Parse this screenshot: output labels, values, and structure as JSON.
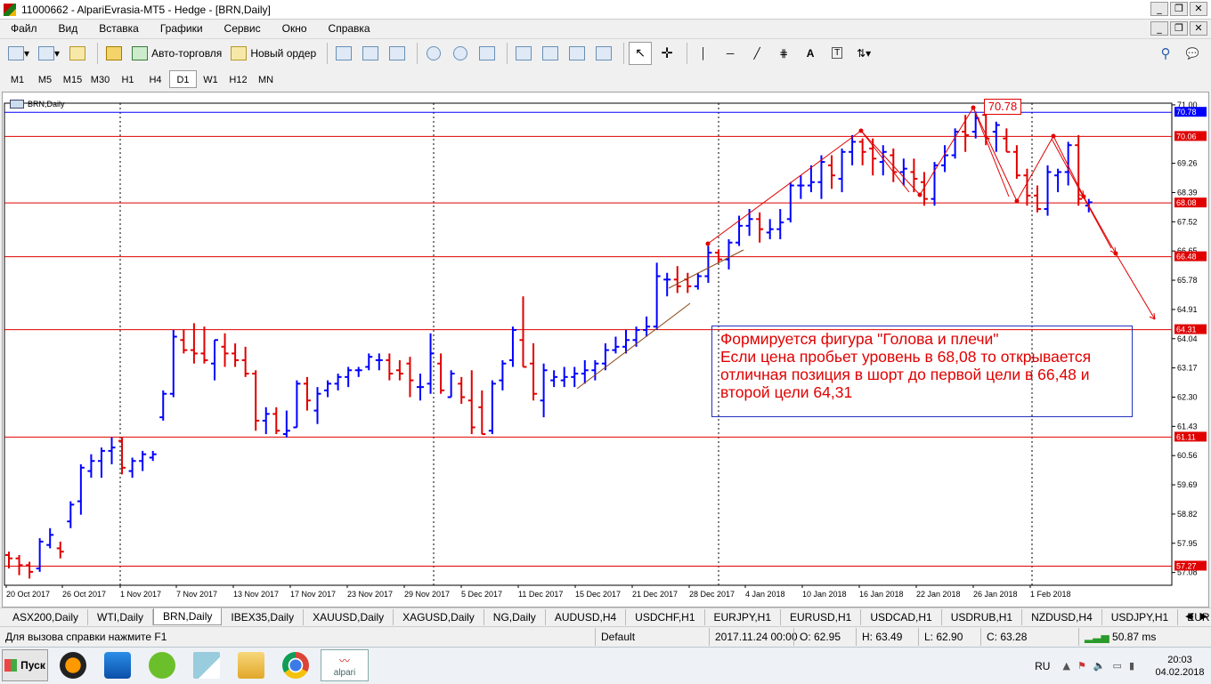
{
  "window": {
    "title": "11000662 - AlpariEvrasia-MT5 - Hedge - [BRN,Daily]"
  },
  "menu": [
    "Файл",
    "Вид",
    "Вставка",
    "Графики",
    "Сервис",
    "Окно",
    "Справка"
  ],
  "toolbar": {
    "autotrade": "Авто-торговля",
    "new_order": "Новый ордер"
  },
  "timeframes": [
    "M1",
    "M5",
    "M15",
    "M30",
    "H1",
    "H4",
    "D1",
    "W1",
    "H12",
    "MN"
  ],
  "active_timeframe": "D1",
  "chart": {
    "symbol_label": "BRN,Daily",
    "highlight_price": "70.78",
    "annotation": [
      "Формируется фигура \"Голова и плечи\"",
      "Если цена пробьет уровень в 68,08 то открывается",
      "отличная позиция в шорт до первой цели в 66,48 и",
      "второй цели 64,31"
    ]
  },
  "chart_data": {
    "type": "bar",
    "symbol": "BRN",
    "timeframe": "Daily",
    "ylim": [
      56.7,
      71.05
    ],
    "y_ticks": [
      71.0,
      70.78,
      70.06,
      69.26,
      68.39,
      68.08,
      67.52,
      66.65,
      66.48,
      65.78,
      64.91,
      64.31,
      64.04,
      63.17,
      62.3,
      61.43,
      61.11,
      60.56,
      59.69,
      58.82,
      57.95,
      57.27,
      57.08
    ],
    "date_labels": [
      "20 Oct 2017",
      "26 Oct 2017",
      "1 Nov 2017",
      "7 Nov 2017",
      "13 Nov 2017",
      "17 Nov 2017",
      "23 Nov 2017",
      "29 Nov 2017",
      "5 Dec 2017",
      "11 Dec 2017",
      "15 Dec 2017",
      "21 Dec 2017",
      "28 Dec 2017",
      "4 Jan 2018",
      "10 Jan 2018",
      "16 Jan 2018",
      "22 Jan 2018",
      "26 Jan 2018",
      "1 Feb 2018"
    ],
    "hlines": [
      {
        "price": 70.78,
        "color": "#0000ff",
        "label": "70.78"
      },
      {
        "price": 70.06,
        "color": "#e00000",
        "label": "70.06"
      },
      {
        "price": 68.08,
        "color": "#e00000",
        "label": "68.08"
      },
      {
        "price": 66.48,
        "color": "#e00000",
        "label": "66.48"
      },
      {
        "price": 64.31,
        "color": "#e00000",
        "label": "64.31"
      },
      {
        "price": 61.11,
        "color": "#e00000",
        "label": "61.11"
      },
      {
        "price": 57.27,
        "color": "#e00000",
        "label": "57.27"
      }
    ],
    "up_color": "#0000ff",
    "down_color": "#e00000",
    "ohlc": [
      [
        57.6,
        57.7,
        57.2,
        57.5
      ],
      [
        57.5,
        57.6,
        57.0,
        57.3
      ],
      [
        57.3,
        57.4,
        56.9,
        57.1
      ],
      [
        57.2,
        58.1,
        57.1,
        58.0
      ],
      [
        57.9,
        58.4,
        57.8,
        58.2
      ],
      [
        57.8,
        58.0,
        57.5,
        57.7
      ],
      [
        58.6,
        59.2,
        58.4,
        59.1
      ],
      [
        59.2,
        60.3,
        58.8,
        60.2
      ],
      [
        60.1,
        60.6,
        59.9,
        60.4
      ],
      [
        60.4,
        60.8,
        59.9,
        60.7
      ],
      [
        60.7,
        61.1,
        60.3,
        60.8
      ],
      [
        61.0,
        61.1,
        60.0,
        60.2
      ],
      [
        60.1,
        60.5,
        59.9,
        60.4
      ],
      [
        60.4,
        60.7,
        60.1,
        60.6
      ],
      [
        60.5,
        60.7,
        60.4,
        60.6
      ],
      [
        61.7,
        62.5,
        61.6,
        62.4
      ],
      [
        62.4,
        64.3,
        62.3,
        64.1
      ],
      [
        64.0,
        64.3,
        63.6,
        63.7
      ],
      [
        63.7,
        64.5,
        63.3,
        63.6
      ],
      [
        63.6,
        64.4,
        63.3,
        63.4
      ],
      [
        63.3,
        64.0,
        62.8,
        64.0
      ],
      [
        63.8,
        64.2,
        63.2,
        63.6
      ],
      [
        63.6,
        63.9,
        63.2,
        63.4
      ],
      [
        63.4,
        63.8,
        62.9,
        63.0
      ],
      [
        63.0,
        63.1,
        61.3,
        61.6
      ],
      [
        61.6,
        62.0,
        61.2,
        61.8
      ],
      [
        61.8,
        62.0,
        61.2,
        61.3
      ],
      [
        61.2,
        61.9,
        61.1,
        61.3
      ],
      [
        61.4,
        62.8,
        61.4,
        62.7
      ],
      [
        62.7,
        62.9,
        61.9,
        62.2
      ],
      [
        61.9,
        62.6,
        61.5,
        62.4
      ],
      [
        62.5,
        62.8,
        62.3,
        62.7
      ],
      [
        62.7,
        63.0,
        62.5,
        62.9
      ],
      [
        62.9,
        63.2,
        62.6,
        63.1
      ],
      [
        63.1,
        63.2,
        62.9,
        63.1
      ],
      [
        63.2,
        63.6,
        63.1,
        63.5
      ],
      [
        63.4,
        63.6,
        63.1,
        63.4
      ],
      [
        63.4,
        63.6,
        62.8,
        63.0
      ],
      [
        63.1,
        63.4,
        62.8,
        63.0
      ],
      [
        63.3,
        63.5,
        62.3,
        62.8
      ],
      [
        62.6,
        63.0,
        62.2,
        62.6
      ],
      [
        62.7,
        64.2,
        62.4,
        63.6
      ],
      [
        63.3,
        63.6,
        62.4,
        62.5
      ],
      [
        62.3,
        63.1,
        62.3,
        63.0
      ],
      [
        62.7,
        62.9,
        62.1,
        62.3
      ],
      [
        62.2,
        63.1,
        61.2,
        61.4
      ],
      [
        62.0,
        62.5,
        61.2,
        61.2
      ],
      [
        61.3,
        62.8,
        61.2,
        62.7
      ],
      [
        62.8,
        63.4,
        62.5,
        63.3
      ],
      [
        63.4,
        64.4,
        63.2,
        64.3
      ],
      [
        64.0,
        65.3,
        63.2,
        63.2
      ],
      [
        63.3,
        63.9,
        62.2,
        62.4
      ],
      [
        62.2,
        63.3,
        61.7,
        63.1
      ],
      [
        62.8,
        63.1,
        62.6,
        62.9
      ],
      [
        62.8,
        63.2,
        62.6,
        62.9
      ],
      [
        62.9,
        63.2,
        62.6,
        63.0
      ],
      [
        63.0,
        63.4,
        62.7,
        63.1
      ],
      [
        63.1,
        63.4,
        62.8,
        63.3
      ],
      [
        63.3,
        63.9,
        63.1,
        63.7
      ],
      [
        63.7,
        64.1,
        63.6,
        63.8
      ],
      [
        63.8,
        64.3,
        63.6,
        64.0
      ],
      [
        64.0,
        64.4,
        63.8,
        64.3
      ],
      [
        64.3,
        64.7,
        64.1,
        64.4
      ],
      [
        64.4,
        66.3,
        64.3,
        65.9
      ],
      [
        65.8,
        66.0,
        65.3,
        65.8
      ],
      [
        65.8,
        66.2,
        65.4,
        65.6
      ],
      [
        65.8,
        66.0,
        65.4,
        65.6
      ],
      [
        65.6,
        66.0,
        65.5,
        65.9
      ],
      [
        65.9,
        66.8,
        65.7,
        66.6
      ],
      [
        66.6,
        66.7,
        66.3,
        66.4
      ],
      [
        66.4,
        67.0,
        66.1,
        66.9
      ],
      [
        66.9,
        67.7,
        66.8,
        67.4
      ],
      [
        67.4,
        67.9,
        67.1,
        67.6
      ],
      [
        67.6,
        67.8,
        66.9,
        67.3
      ],
      [
        67.2,
        67.6,
        67.0,
        67.3
      ],
      [
        67.3,
        67.9,
        67.0,
        67.5
      ],
      [
        67.6,
        68.7,
        67.5,
        68.6
      ],
      [
        68.6,
        68.9,
        68.2,
        68.6
      ],
      [
        68.6,
        69.2,
        68.4,
        68.7
      ],
      [
        68.7,
        69.5,
        68.2,
        69.3
      ],
      [
        69.2,
        69.5,
        68.5,
        68.9
      ],
      [
        68.8,
        69.7,
        68.4,
        69.6
      ],
      [
        69.6,
        70.1,
        69.2,
        69.9
      ],
      [
        69.9,
        70.0,
        69.2,
        69.6
      ],
      [
        69.7,
        70.0,
        68.9,
        69.4
      ],
      [
        69.3,
        69.8,
        68.9,
        69.6
      ],
      [
        69.5,
        69.7,
        68.7,
        69.0
      ],
      [
        69.0,
        69.4,
        68.6,
        69.1
      ],
      [
        69.0,
        69.4,
        68.4,
        68.8
      ],
      [
        68.7,
        69.0,
        68.0,
        68.2
      ],
      [
        68.2,
        69.3,
        68.0,
        69.2
      ],
      [
        69.2,
        69.8,
        69.0,
        69.5
      ],
      [
        69.5,
        70.3,
        69.4,
        70.2
      ],
      [
        70.2,
        70.7,
        69.6,
        70.1
      ],
      [
        70.2,
        70.8,
        70.0,
        70.6
      ],
      [
        70.7,
        70.8,
        69.8,
        70.0
      ],
      [
        70.2,
        70.5,
        69.6,
        70.4
      ],
      [
        70.0,
        70.3,
        69.6,
        69.6
      ],
      [
        69.6,
        69.8,
        68.8,
        68.9
      ],
      [
        68.9,
        69.1,
        68.0,
        68.3
      ],
      [
        68.3,
        68.6,
        67.8,
        67.9
      ],
      [
        67.9,
        69.2,
        67.7,
        69.0
      ],
      [
        68.9,
        69.1,
        68.4,
        69.0
      ],
      [
        69.0,
        69.9,
        68.6,
        69.8
      ],
      [
        69.8,
        70.1,
        68.0,
        68.2
      ],
      [
        68.0,
        68.2,
        67.8,
        68.1
      ]
    ]
  },
  "symbol_tabs": [
    "ASX200,Daily",
    "WTI,Daily",
    "BRN,Daily",
    "IBEX35,Daily",
    "XAUUSD,Daily",
    "XAGUSD,Daily",
    "NG,Daily",
    "AUDUSD,H4",
    "USDCHF,H1",
    "EURJPY,H1",
    "EURUSD,H1",
    "USDCAD,H1",
    "USDRUB,H1",
    "NZDUSD,H4",
    "USDJPY,H1",
    "EUR"
  ],
  "active_tab": "BRN,Daily",
  "status": {
    "help": "Для вызова справки нажмите F1",
    "profile": "Default",
    "datetime": "2017.11.24 00:00",
    "open": "O: 62.95",
    "high": "H: 63.49",
    "low": "L: 62.90",
    "close": "C: 63.28",
    "ping": "50.87 ms"
  },
  "taskbar": {
    "start": "Пуск",
    "lang": "RU",
    "time": "20:03",
    "date": "04.02.2018",
    "alpari_label": "alpari"
  }
}
